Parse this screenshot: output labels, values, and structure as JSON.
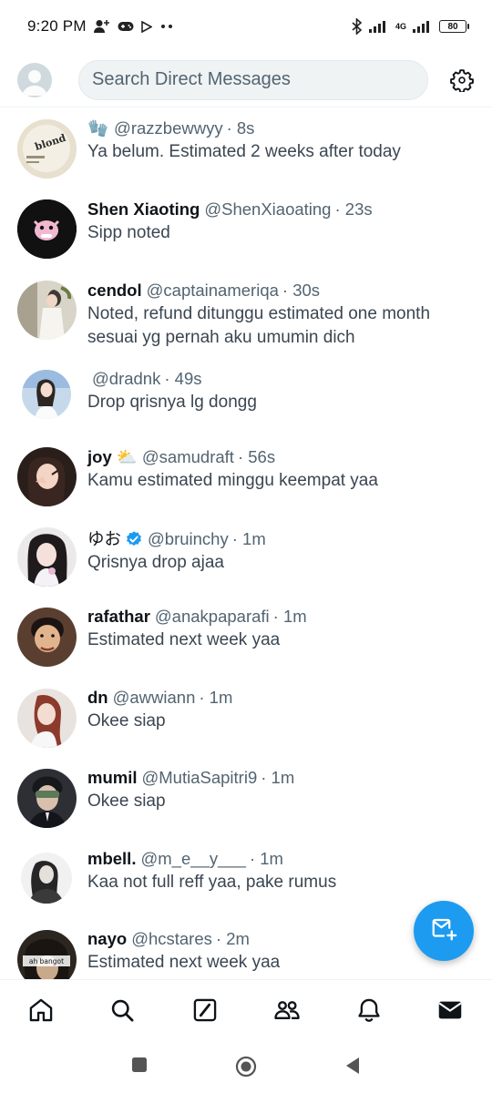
{
  "status_bar": {
    "time": "9:20 PM",
    "network": "4G",
    "battery": "80"
  },
  "header": {
    "search_placeholder": "Search Direct Messages"
  },
  "conversations": [
    {
      "emoji": "🧤",
      "name": "",
      "handle": "@razzbewwyy",
      "time": "· 8s",
      "message": "Ya belum. Estimated 2 weeks after today"
    },
    {
      "emoji": "",
      "name": "Shen Xiaoting",
      "handle": "@ShenXiaoating",
      "time": "· 23s",
      "message": "Sipp noted"
    },
    {
      "emoji": "",
      "name": "cendol",
      "handle": "@captainameriqa",
      "time": "· 30s",
      "message": "Noted, refund ditunggu estimated one month sesuai yg pernah aku umumin dich"
    },
    {
      "emoji": "",
      "name": "",
      "handle": "@dradnk",
      "time": "· 49s",
      "message": "Drop qrisnya lg dongg"
    },
    {
      "emoji": "",
      "name": "joy ⛅",
      "handle": "@samudraft",
      "time": "· 56s",
      "message": "Kamu estimated minggu keempat yaa"
    },
    {
      "emoji": "",
      "name": "ゆお",
      "handle": "@bruinchy",
      "time": "· 1m",
      "message": "Qrisnya drop ajaa",
      "verified": true
    },
    {
      "emoji": "",
      "name": "rafathar",
      "handle": "@anakpaparafi",
      "time": "· 1m",
      "message": "Estimated next week yaa"
    },
    {
      "emoji": "",
      "name": "dn",
      "handle": "@awwiann",
      "time": "· 1m",
      "message": "Okee siap"
    },
    {
      "emoji": "",
      "name": "mumil",
      "handle": "@MutiaSapitri9",
      "time": "· 1m",
      "message": "Okee siap"
    },
    {
      "emoji": "",
      "name": "mbell.",
      "handle": "@m_e__y___",
      "time": "· 1m",
      "message": "Kaa not full reff yaa, pake rumus"
    },
    {
      "emoji": "",
      "name": "nayo",
      "handle": "@hcstares",
      "time": "· 2m",
      "message": "Estimated next week yaa"
    }
  ],
  "avatar_labels": {
    "first": "blond",
    "last": "ah bangot"
  },
  "icons": {
    "nav": [
      "home-icon",
      "search-icon",
      "compose-icon",
      "communities-icon",
      "notifications-icon",
      "messages-icon"
    ],
    "fab": "new-message-icon",
    "settings": "gear-icon"
  },
  "colors": {
    "accent": "#1d9bf0",
    "text_primary": "#0f1419",
    "text_secondary": "#536471"
  }
}
